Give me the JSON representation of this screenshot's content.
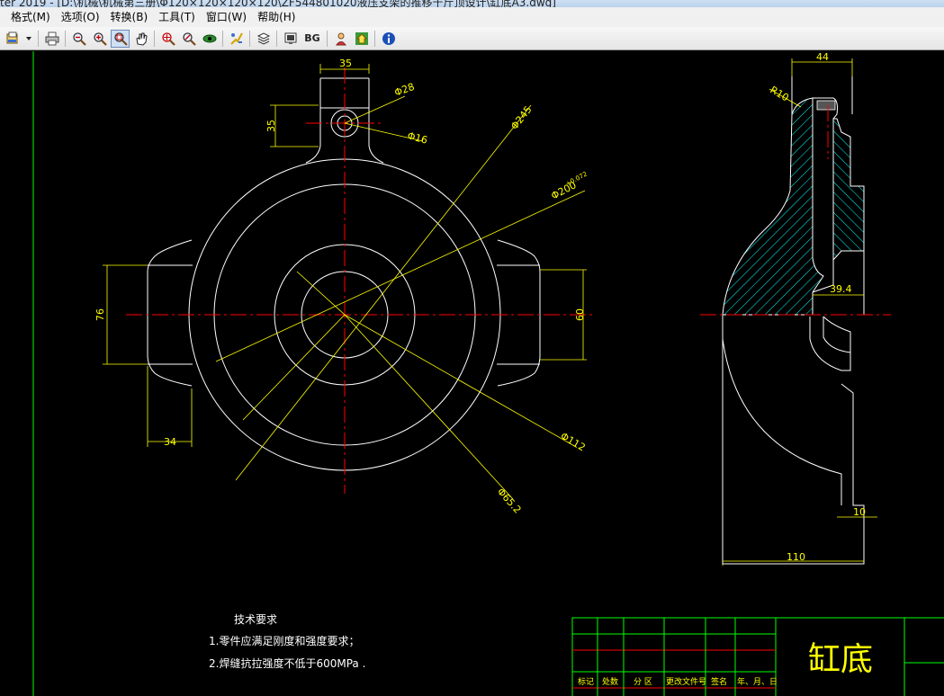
{
  "window": {
    "title": "ter 2019 - [D:\\机械\\机械第三册\\Φ120×120×120×120\\ZF544801020液压支架的推移千斤顶设计\\缸底A3.dwg]"
  },
  "menu": [
    {
      "id": "format",
      "label": "格式(M)"
    },
    {
      "id": "options",
      "label": "选项(O)"
    },
    {
      "id": "convert",
      "label": "转换(B)"
    },
    {
      "id": "tools",
      "label": "工具(T)"
    },
    {
      "id": "window",
      "label": "窗口(W)"
    },
    {
      "id": "help",
      "label": "帮助(H)"
    }
  ],
  "toolbar": {
    "bg_label": "BG",
    "icons": [
      "open-icon",
      "dropdown-icon",
      "print-icon",
      "zoom-out-icon",
      "zoom-in-icon",
      "zoom-window-icon",
      "pan-icon",
      "zoom-extents-icon",
      "zoom-realtime-icon",
      "eye-icon",
      "layer-icon",
      "layers-list-icon",
      "screen-icon",
      "bg-icon",
      "find-icon",
      "home-icon",
      "info-icon"
    ],
    "active_icon": "zoom-window-icon"
  },
  "drawing": {
    "colors": {
      "outline": "#ffffff",
      "dimension": "#ffff00",
      "center": "#ff0000",
      "hatch": "#00ffff",
      "frame": "#00ff00",
      "tb_red": "#ff0000"
    },
    "dims": {
      "top_width": "35",
      "top_height": "35",
      "hole_outer": "Φ28",
      "hole_inner": "Φ16",
      "d245": "Φ245",
      "d200": "Φ200",
      "d200_tol": "+0.072",
      "d112": "Φ112",
      "d65": "Φ65.2",
      "left_height": "76",
      "right_height": "60",
      "bottom_width": "34",
      "side_top": "44",
      "side_r": "R10",
      "side_394": "39.4",
      "side_10": "10",
      "side_110": "110"
    },
    "tech_req": {
      "title": "技术要求",
      "line1": "1.零件应满足刚度和强度要求；",
      "line2": "2.焊缝抗拉强度不低于600MPa ."
    },
    "title_block": {
      "part_name": "缸底",
      "headers": [
        "标记",
        "处数",
        "分 区",
        "更改文件号",
        "签名",
        "年、月、日"
      ]
    }
  }
}
